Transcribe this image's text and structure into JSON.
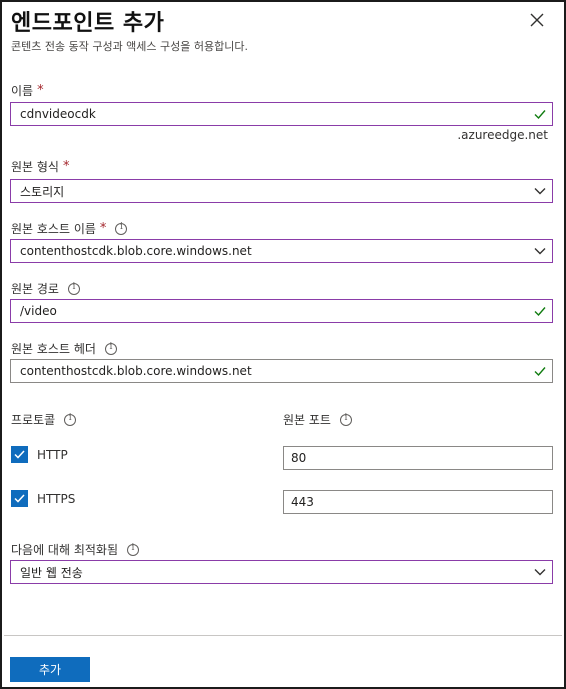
{
  "panel": {
    "title": "엔드포인트 추가",
    "subtitle": "콘텐츠 전송 동작 구성과 액세스 구성을 허용합니다."
  },
  "name": {
    "label": "이름",
    "required": "*",
    "value": "cdnvideocdk",
    "suffix": ".azureedge.net"
  },
  "origin_type": {
    "label": "원본 형식",
    "required": "*",
    "value": "스토리지"
  },
  "origin_hostname": {
    "label": "원본 호스트 이름",
    "required": "*",
    "value": "contenthostcdk.blob.core.windows.net"
  },
  "origin_path": {
    "label": "원본 경로",
    "value": "/video"
  },
  "origin_host_header": {
    "label": "원본 호스트 헤더",
    "value": "contenthostcdk.blob.core.windows.net"
  },
  "protocol": {
    "label": "프로토콜",
    "http_label": "HTTP",
    "https_label": "HTTPS",
    "http_checked": true,
    "https_checked": true
  },
  "origin_port": {
    "label": "원본 포트",
    "http_port": "80",
    "https_port": "443"
  },
  "optimized_for": {
    "label": "다음에 대해 최적화됨",
    "value": "일반 웹 전송"
  },
  "footer": {
    "add_label": "추가"
  },
  "colors": {
    "accent": "#0f6cbd",
    "valid_check": "#107c10",
    "required_star": "#a4262c",
    "active_border": "#8a3ca8"
  }
}
